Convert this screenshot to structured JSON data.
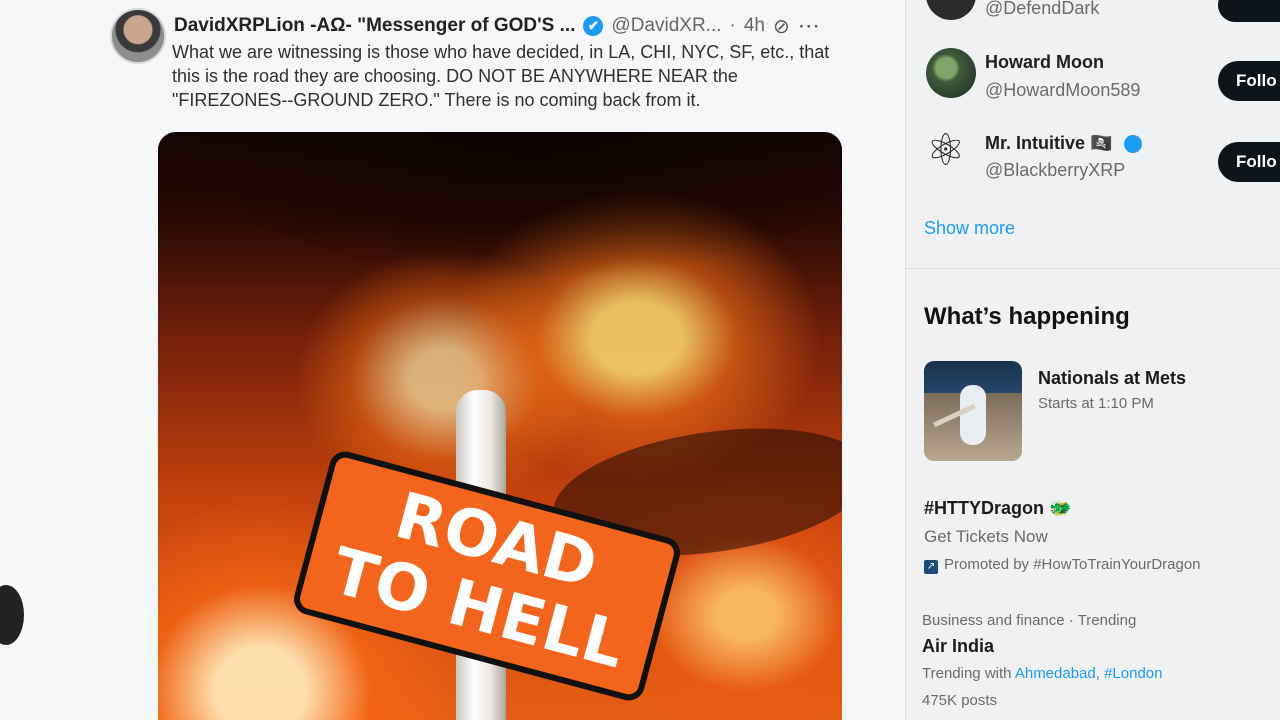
{
  "tweet": {
    "author_name": "DavidXRPLion -AΩ- \"Messenger of GOD'S ...",
    "verified_icon": "✔",
    "handle": "@DavidXR...",
    "separator": "·",
    "time": "4h",
    "grok_icon": "⊘",
    "more_icon": "⋯",
    "text": "What we are witnessing is those who have decided, in LA, CHI, NYC, SF, etc., that this is the road they are choosing. DO NOT BE ANYWHERE NEAR the \"FIREZONES--GROUND ZERO.\" There is no coming back from it.",
    "media": {
      "sign_line_1": "ROAD",
      "sign_line_2": "TO HELL"
    }
  },
  "sidebar": {
    "who_to_follow": [
      {
        "name": "",
        "handle": "@DefendDark"
      },
      {
        "name": "Howard Moon",
        "handle": "@HowardMoon589",
        "button": "Follo"
      },
      {
        "name": "Mr. Intuitive 🏴‍☠️",
        "handle": "@BlackberryXRP",
        "button": "Follo",
        "atom_icon": "⚛"
      }
    ],
    "show_more": "Show more",
    "whats_happening": {
      "title": "What’s happening",
      "event": {
        "title": "Nationals at Mets",
        "subtitle": "Starts at 1:10 PM"
      },
      "promoted": {
        "title": "#HTTYDragon 🐲",
        "subtitle": "Get Tickets Now",
        "promo_icon": "↗",
        "promoted_by": "Promoted by #HowToTrainYourDragon"
      },
      "trend": {
        "context": "Business and finance · Trending",
        "title": "Air India",
        "trending_with": "Trending with",
        "link1": "Ahmedabad",
        "comma": ",",
        "link2": "#London",
        "posts": "475K posts"
      }
    }
  },
  "colors": {
    "accent": "#1d9bf0",
    "follow_button": "#0f1419",
    "sign_orange": "#f3651c"
  }
}
